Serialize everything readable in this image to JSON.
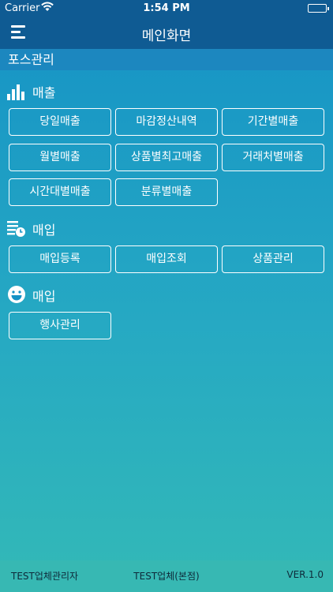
{
  "status": {
    "carrier": "Carrier",
    "time": "1:54 PM"
  },
  "nav": {
    "title": "메인화면"
  },
  "section": {
    "title": "포스관리"
  },
  "groups": [
    {
      "title": "매출",
      "icon": "bar-chart-icon",
      "buttons": [
        "당일매출",
        "마감정산내역",
        "기간별매출",
        "월별매출",
        "상품별최고매출",
        "거래처별매출",
        "시간대별매출",
        "분류별매출"
      ]
    },
    {
      "title": "매입",
      "icon": "document-clock-icon",
      "buttons": [
        "매입등록",
        "매입조회",
        "상품관리"
      ]
    },
    {
      "title": "매입",
      "icon": "smiley-icon",
      "buttons": [
        "행사관리"
      ]
    }
  ],
  "footer": {
    "user": "TEST업체관리자",
    "store": "TEST업체(본점)",
    "version": "VER.1.0"
  },
  "colors": {
    "header": "#0f5b93",
    "section": "#1c87bf",
    "footer": "#37b8b3"
  }
}
